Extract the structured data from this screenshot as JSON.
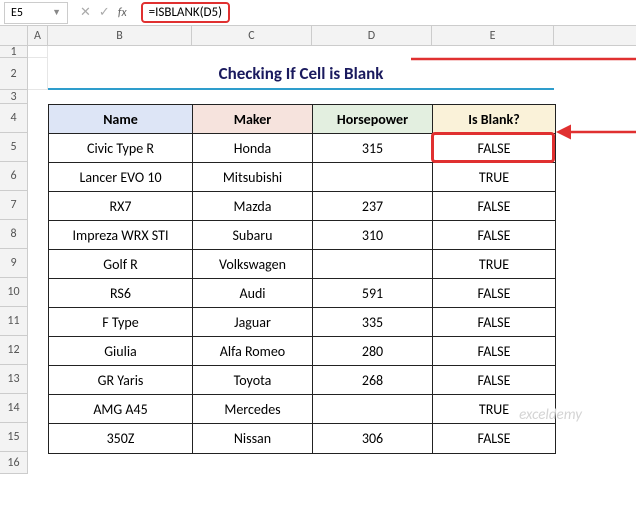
{
  "formula_bar": {
    "cell_ref": "E5",
    "formula": "=ISBLANK(D5)",
    "fx": "fx"
  },
  "columns": [
    "A",
    "B",
    "C",
    "D",
    "E"
  ],
  "rows": [
    "1",
    "2",
    "3",
    "4",
    "5",
    "6",
    "7",
    "8",
    "9",
    "10",
    "11",
    "12",
    "13",
    "14",
    "15",
    "16"
  ],
  "title": "Checking If Cell is Blank",
  "headers": {
    "name": "Name",
    "maker": "Maker",
    "hp": "Horsepower",
    "blank": "Is Blank?"
  },
  "data": [
    {
      "name": "Civic Type R",
      "maker": "Honda",
      "hp": "315",
      "blank": "FALSE"
    },
    {
      "name": "Lancer EVO 10",
      "maker": "Mitsubishi",
      "hp": "",
      "blank": "TRUE"
    },
    {
      "name": "RX7",
      "maker": "Mazda",
      "hp": "237",
      "blank": "FALSE"
    },
    {
      "name": "Impreza WRX STI",
      "maker": "Subaru",
      "hp": "310",
      "blank": "FALSE"
    },
    {
      "name": "Golf R",
      "maker": "Volkswagen",
      "hp": "",
      "blank": "TRUE"
    },
    {
      "name": "RS6",
      "maker": "Audi",
      "hp": "591",
      "blank": "FALSE"
    },
    {
      "name": "F Type",
      "maker": "Jaguar",
      "hp": "335",
      "blank": "FALSE"
    },
    {
      "name": "Giulia",
      "maker": "Alfa Romeo",
      "hp": "280",
      "blank": "FALSE"
    },
    {
      "name": "GR Yaris",
      "maker": "Toyota",
      "hp": "268",
      "blank": "FALSE"
    },
    {
      "name": "AMG A45",
      "maker": "Mercedes",
      "hp": "",
      "blank": "TRUE"
    },
    {
      "name": "350Z",
      "maker": "Nissan",
      "hp": "306",
      "blank": "FALSE"
    }
  ],
  "watermark": "exceldemy"
}
